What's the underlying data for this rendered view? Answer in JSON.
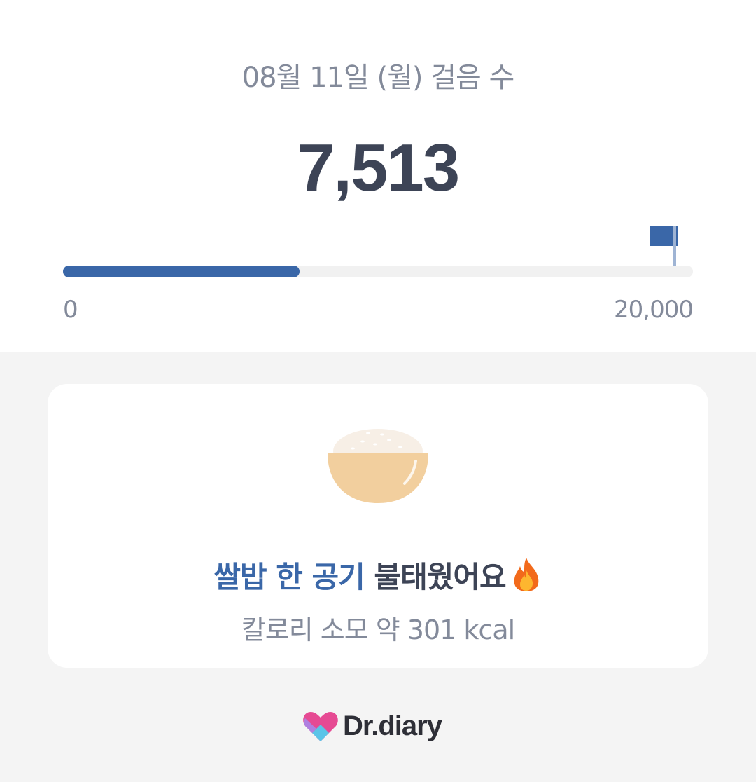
{
  "header": {
    "date_title": "08월 11일 (월) 걸음 수",
    "step_count": "7,513"
  },
  "progress": {
    "current_steps": 7513,
    "goal_steps": 20000,
    "min_label": "0",
    "max_label": "20,000",
    "fill_color": "#3a67a8"
  },
  "card": {
    "food_icon": "rice-bowl-icon",
    "food_text": "쌀밥 한 공기",
    "burn_text": " 불태웠어요",
    "fire_icon": "fire-icon",
    "calorie_text": "칼로리 소모 약 301 kcal"
  },
  "brand": {
    "name": "Dr.diary",
    "logo_icon": "heart-logo-icon"
  },
  "colors": {
    "accent": "#3a67a8",
    "text_dark": "#3d4456",
    "text_muted": "#838a9a",
    "background": "#f4f4f4"
  }
}
